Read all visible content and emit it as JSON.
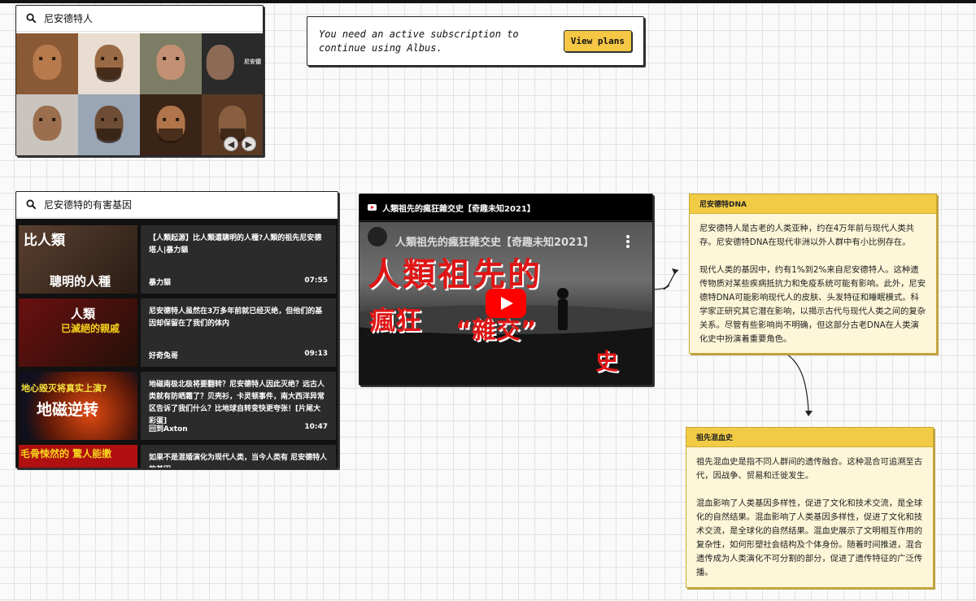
{
  "image_search": {
    "query": "尼安德特人",
    "thumb_text": "尼安德"
  },
  "notice": {
    "message": "You need an active subscription to continue using Albus.",
    "button_label": "View plans"
  },
  "video_search": {
    "query": "尼安德特的有害基因",
    "videos": [
      {
        "title": "【人類起源】比人類還聰明的人種?人類的祖先尼安德塔人|暴力貓",
        "channel": "暴力貓",
        "duration": "07:55",
        "thumb_line1": "比人類",
        "thumb_line2": "聰明的人種"
      },
      {
        "title": "尼安德特人虽然在3万多年前就已经灭绝，但他们的基因却保留在了我们的体内",
        "channel": "好奇兔哥",
        "duration": "09:13",
        "thumb_line1": "人類",
        "thumb_line2": "已滅絕的親戚"
      },
      {
        "title": "地磁南极北极将要翻转？尼安德特人因此灭绝？远古人类就有防晒霜了？贝壳衫，卡灵顿事件，南大西洋异常区告诉了我们什么？比地球自转变快更夸张！[片尾大彩蛋]",
        "channel": "回到Axton",
        "duration": "10:47",
        "thumb_line1": "地心毁灭将真实上演?",
        "thumb_line2": "地磁逆转"
      },
      {
        "title": "如果不是混婚演化为现代人类，当今人类有 尼安德特人的基因",
        "channel": "",
        "duration": "",
        "thumb_line1": "毛骨悚然的 驚人能擻",
        "thumb_line2": ""
      }
    ]
  },
  "player": {
    "title": "人類祖先的瘋狂雜交史【奇趣未知2021】",
    "overlay_title": "人類祖先的瘋狂雜交史【奇趣未知2021】",
    "big_text_1": "人類祖先的",
    "big_text_2": "瘋狂",
    "big_text_3": "“雜交”",
    "big_text_4": "史"
  },
  "notes": [
    {
      "title": "尼安德特DNA",
      "paragraphs": [
        "尼安德特人是古老的人类亚种，约在4万年前与现代人类共存。尼安德特DNA在现代非洲以外人群中有小比例存在。",
        "现代人类的基因中，约有1%到2%来自尼安德特人。这种遗传物质对某些疾病抵抗力和免疫系统可能有影响。此外，尼安德特DNA可能影响现代人的皮肤、头发特征和睡眠模式。科学家正研究其它潜在影响，以揭示古代与现代人类之间的复杂关系。尽管有些影响尚不明确，但这部分古老DNA在人类演化史中扮演着重要角色。"
      ]
    },
    {
      "title": "祖先混血史",
      "paragraphs": [
        "祖先混血史是指不同人群间的遗传融合。这种混合可追溯至古代，因战争、贸易和迁徙发生。",
        "混血影响了人类基因多样性，促进了文化和技术交流，是全球化的自然结果。混血影响了人类基因多样性，促进了文化和技术交流，是全球化的自然结果。混血史展示了文明相互作用的复杂性，如何形塑社会结构及个体身份。随着时间推进，混合遗传成为人类演化不可分割的部分，促进了遗传特征的广泛传播。"
      ]
    }
  ],
  "colors": {
    "note_header": "#f2cb45",
    "note_body": "#fdf6d8",
    "button": "#f6c744",
    "play_button": "#ff0000"
  }
}
